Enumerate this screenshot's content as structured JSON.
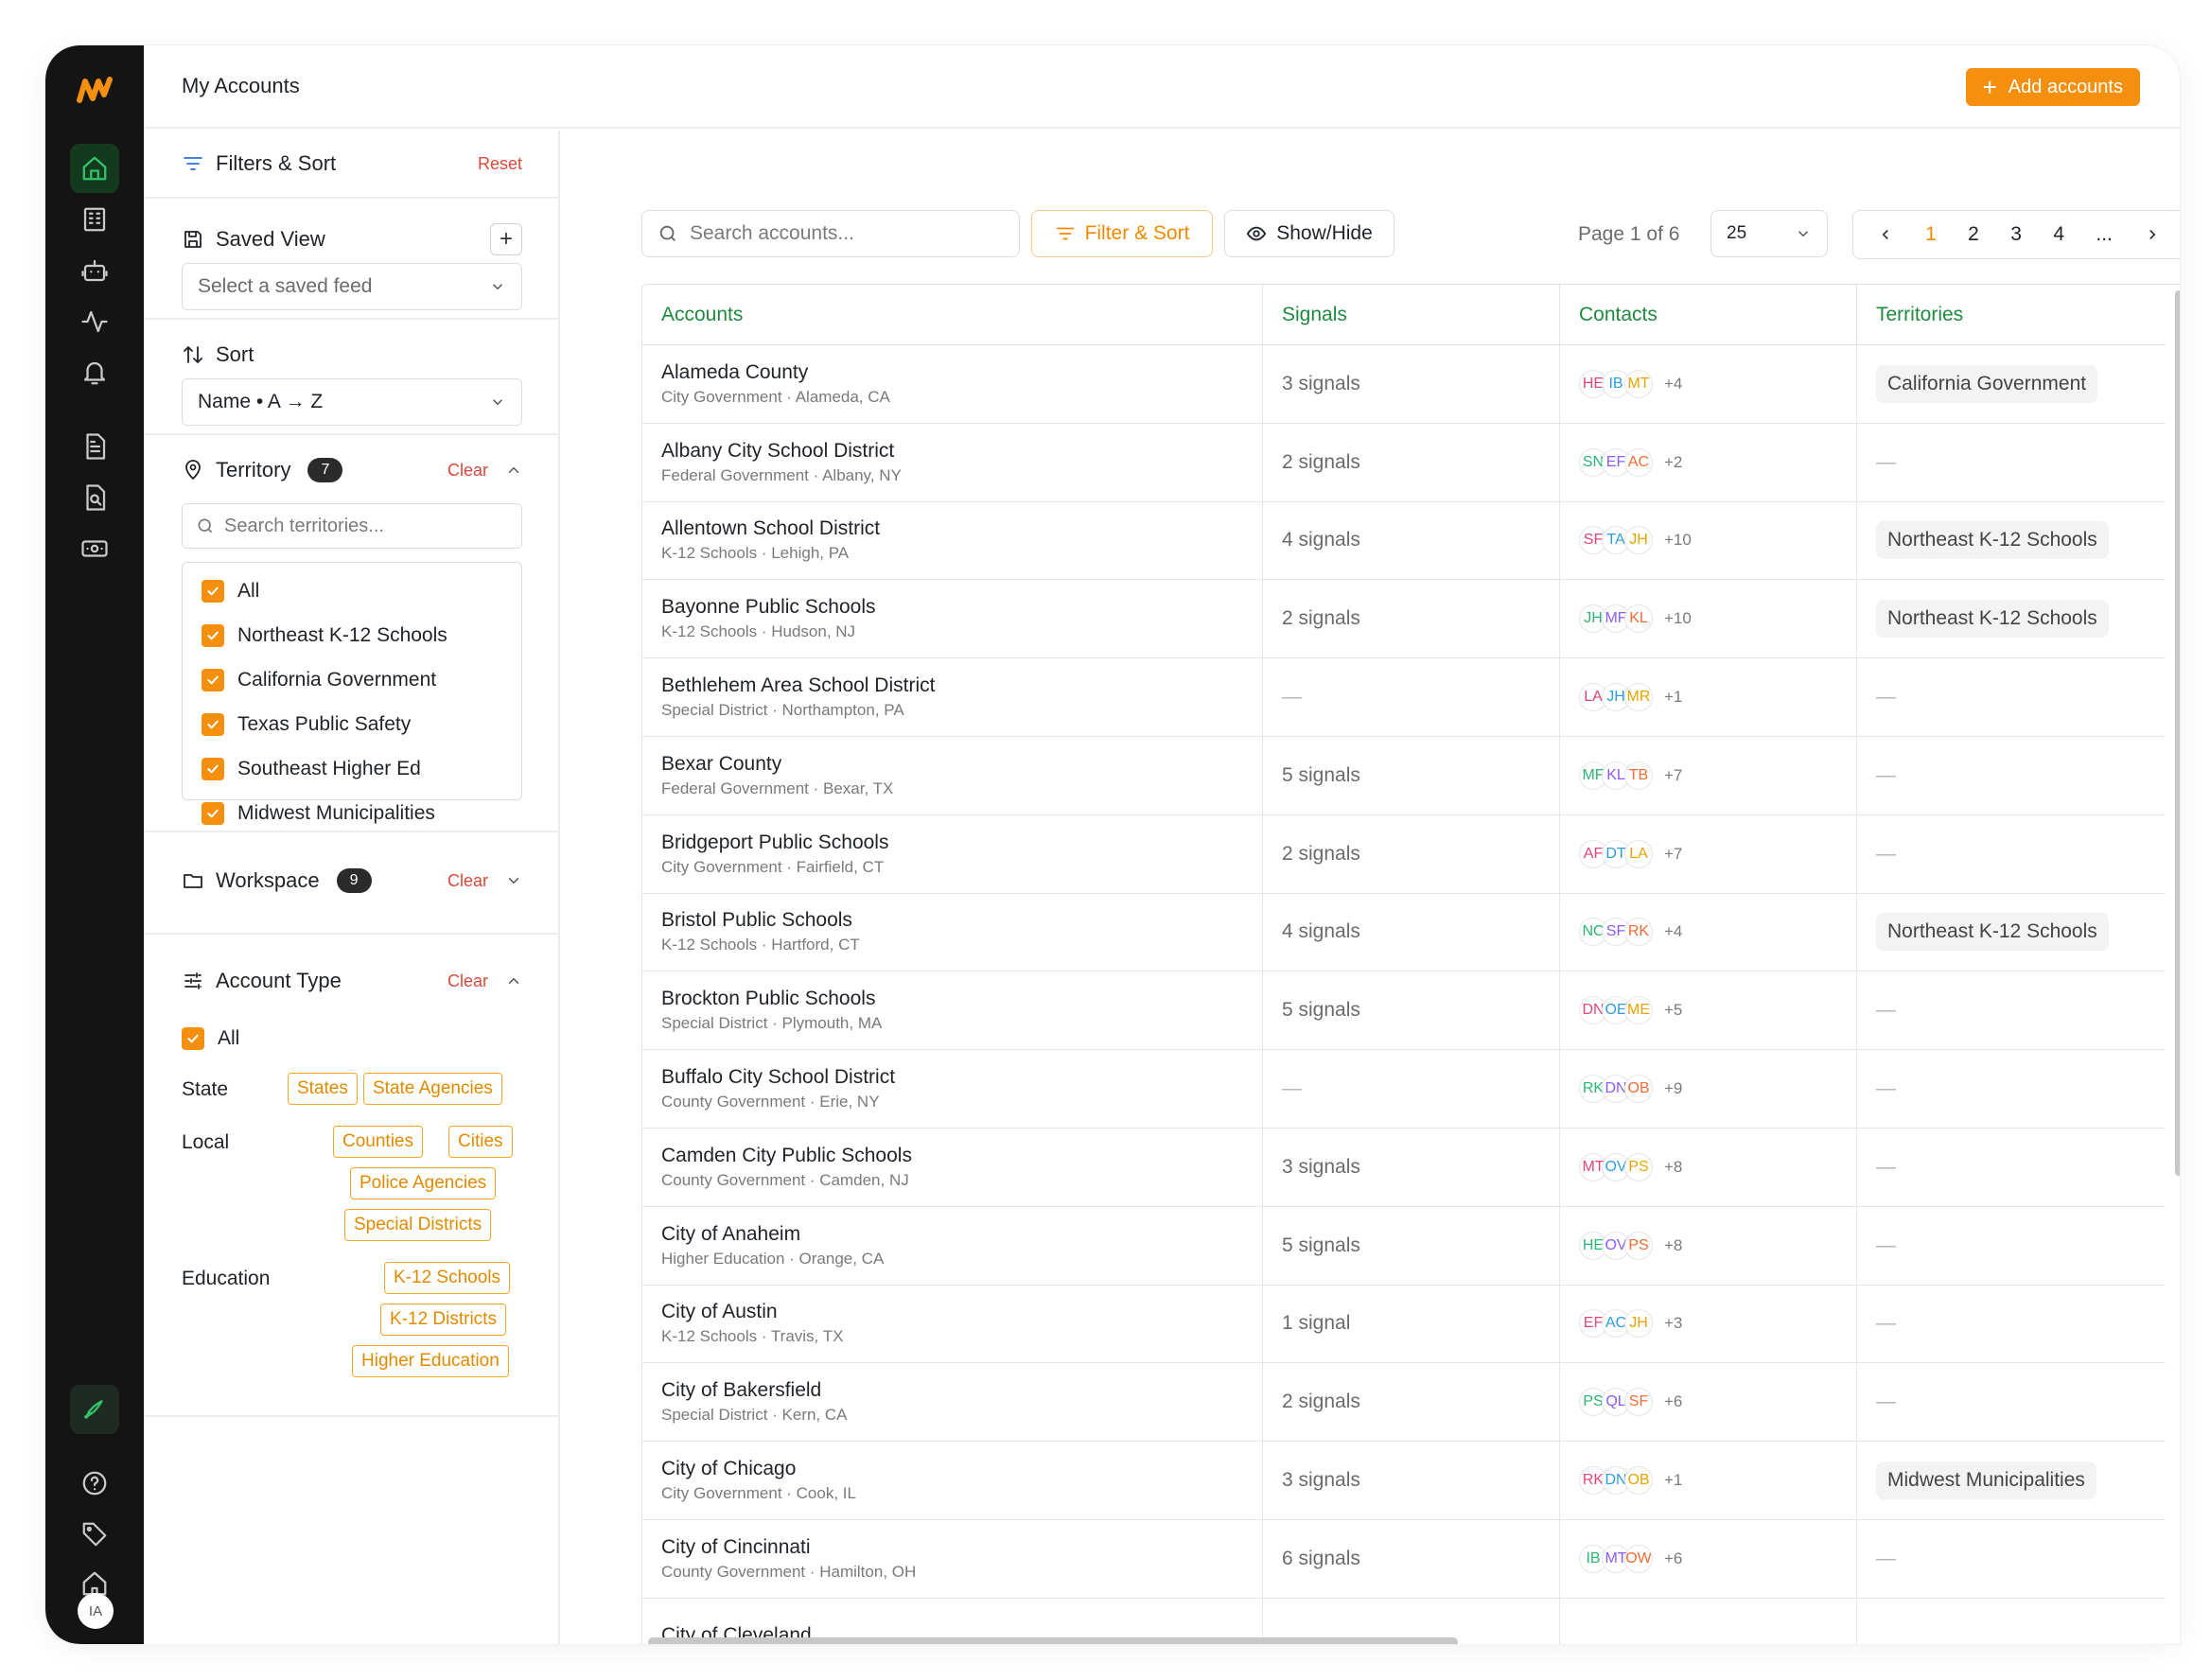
{
  "app": {
    "title": "My Accounts",
    "add_button": "Add accounts",
    "avatar_initials": "IA"
  },
  "rail": {
    "items": [
      "home-icon",
      "building-icon",
      "bot-icon",
      "activity-icon",
      "bell-icon",
      "document-icon",
      "search-document-icon",
      "money-icon",
      "rocket-icon",
      "help-icon",
      "tag-icon",
      "house-icon"
    ]
  },
  "filters": {
    "title": "Filters & Sort",
    "reset": "Reset",
    "saved_view": {
      "title": "Saved View",
      "placeholder": "Select a saved feed"
    },
    "sort": {
      "title": "Sort",
      "value": "Name • A → Z"
    },
    "territory": {
      "title": "Territory",
      "count": "7",
      "clear": "Clear",
      "search_placeholder": "Search territories...",
      "options": [
        "All",
        "Northeast K-12 Schools",
        "California Government",
        "Texas Public Safety",
        "Southeast Higher Ed",
        "Midwest Municipalities"
      ]
    },
    "workspace": {
      "title": "Workspace",
      "count": "9",
      "clear": "Clear"
    },
    "account_type": {
      "title": "Account Type",
      "clear": "Clear",
      "all": "All",
      "state_label": "State",
      "state_chips": [
        "States",
        "State Agencies"
      ],
      "local_label": "Local",
      "local_chips": [
        "Counties",
        "Cities",
        "Police Agencies",
        "Special Districts"
      ],
      "education_label": "Education",
      "education_chips": [
        "K-12 Schools",
        "K-12 Districts",
        "Higher Education"
      ]
    }
  },
  "toolbar": {
    "search_placeholder": "Search accounts...",
    "filter_sort": "Filter & Sort",
    "show_hide": "Show/Hide",
    "page_info": "Page 1 of 6",
    "per_page": "25",
    "pages": [
      "1",
      "2",
      "3",
      "4",
      "..."
    ]
  },
  "table": {
    "headers": [
      "Accounts",
      "Signals",
      "Contacts",
      "Territories"
    ],
    "rows": [
      {
        "name": "Alameda County",
        "sub": "City Government · Alameda, CA",
        "signals": "3 signals",
        "avatars": [
          "HE",
          "IB",
          "MT"
        ],
        "more": "+4",
        "territory": "California Government"
      },
      {
        "name": "Albany City School District",
        "sub": "Federal Government · Albany, NY",
        "signals": "2 signals",
        "avatars": [
          "SN",
          "EF",
          "AC"
        ],
        "more": "+2",
        "territory": "—"
      },
      {
        "name": "Allentown School District",
        "sub": "K-12 Schools · Lehigh, PA",
        "signals": "4 signals",
        "avatars": [
          "SF",
          "TA",
          "JH"
        ],
        "more": "+10",
        "territory": "Northeast K-12 Schools"
      },
      {
        "name": "Bayonne Public Schools",
        "sub": "K-12 Schools · Hudson, NJ",
        "signals": "2 signals",
        "avatars": [
          "JH",
          "MF",
          "KL"
        ],
        "more": "+10",
        "territory": "Northeast K-12 Schools"
      },
      {
        "name": "Bethlehem Area School District",
        "sub": "Special District · Northampton, PA",
        "signals": "—",
        "avatars": [
          "LA",
          "JH",
          "MR"
        ],
        "more": "+1",
        "territory": "—"
      },
      {
        "name": "Bexar County",
        "sub": "Federal Government · Bexar, TX",
        "signals": "5 signals",
        "avatars": [
          "MF",
          "KL",
          "TB"
        ],
        "more": "+7",
        "territory": "—"
      },
      {
        "name": "Bridgeport Public Schools",
        "sub": "City Government · Fairfield, CT",
        "signals": "2 signals",
        "avatars": [
          "AF",
          "DT",
          "LA"
        ],
        "more": "+7",
        "territory": "—"
      },
      {
        "name": "Bristol Public Schools",
        "sub": "K-12 Schools · Hartford, CT",
        "signals": "4 signals",
        "avatars": [
          "NC",
          "SF",
          "RK"
        ],
        "more": "+4",
        "territory": "Northeast K-12 Schools"
      },
      {
        "name": "Brockton Public Schools",
        "sub": "Special District · Plymouth, MA",
        "signals": "5 signals",
        "avatars": [
          "DN",
          "OE",
          "ME"
        ],
        "more": "+5",
        "territory": "—"
      },
      {
        "name": "Buffalo City School District",
        "sub": "County Government · Erie, NY",
        "signals": "—",
        "avatars": [
          "RK",
          "DN",
          "OB"
        ],
        "more": "+9",
        "territory": "—"
      },
      {
        "name": "Camden City Public Schools",
        "sub": "County Government · Camden, NJ",
        "signals": "3 signals",
        "avatars": [
          "MT",
          "OV",
          "PS"
        ],
        "more": "+8",
        "territory": "—"
      },
      {
        "name": "City of Anaheim",
        "sub": "Higher Education · Orange, CA",
        "signals": "5 signals",
        "avatars": [
          "HE",
          "OV",
          "PS"
        ],
        "more": "+8",
        "territory": "—"
      },
      {
        "name": "City of Austin",
        "sub": "K-12 Schools · Travis, TX",
        "signals": "1 signal",
        "avatars": [
          "EF",
          "AC",
          "JH"
        ],
        "more": "+3",
        "territory": "—"
      },
      {
        "name": "City of Bakersfield",
        "sub": "Special District · Kern, CA",
        "signals": "2 signals",
        "avatars": [
          "PS",
          "QL",
          "SF"
        ],
        "more": "+6",
        "territory": "—"
      },
      {
        "name": "City of Chicago",
        "sub": "City Government · Cook, IL",
        "signals": "3 signals",
        "avatars": [
          "RK",
          "DN",
          "OB"
        ],
        "more": "+1",
        "territory": "Midwest Municipalities"
      },
      {
        "name": "City of Cincinnati",
        "sub": "County Government · Hamilton, OH",
        "signals": "6 signals",
        "avatars": [
          "IB",
          "MT",
          "OW"
        ],
        "more": "+6",
        "territory": "—"
      },
      {
        "name": "City of Cleveland",
        "sub": "",
        "signals": "",
        "avatars": [],
        "more": "",
        "territory": ""
      }
    ]
  },
  "colors": {
    "accent": "#f5900f",
    "header_green": "#1f8a3e",
    "danger": "#d9483b",
    "rail": "#141414"
  }
}
